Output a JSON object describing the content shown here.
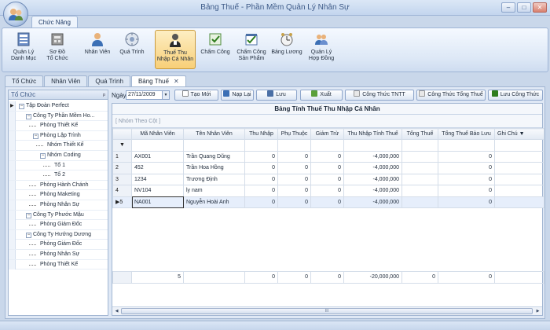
{
  "window": {
    "title": "Bảng Thuế - Phần Mềm Quản Lý Nhân Sự",
    "buttons": {
      "minimize": "–",
      "maximize": "□",
      "close": "✕"
    }
  },
  "ribbon": {
    "tab_label": "Chức Năng",
    "buttons": [
      {
        "line1": "Quản Lý",
        "line2": "Danh Mục",
        "icon": "catalog-icon"
      },
      {
        "line1": "Sơ Đồ",
        "line2": "Tổ Chức",
        "icon": "org-chart-icon"
      },
      {
        "line1": "Nhân Viên",
        "line2": "",
        "icon": "employee-icon"
      },
      {
        "line1": "Quá Trình",
        "line2": "",
        "icon": "process-icon"
      },
      {
        "line1": "Thuế Thu",
        "line2": "Nhập Cá Nhân",
        "icon": "tax-icon"
      },
      {
        "line1": "Chấm Công",
        "line2": "",
        "icon": "attendance-icon"
      },
      {
        "line1": "Chấm Công",
        "line2": "Sản Phẩm",
        "icon": "product-attendance-icon"
      },
      {
        "line1": "Bảng Lương",
        "line2": "",
        "icon": "payroll-icon"
      },
      {
        "line1": "Quản Lý",
        "line2": "Hợp Đồng",
        "icon": "contract-icon"
      }
    ]
  },
  "doc_tabs": [
    "Tổ Chức",
    "Nhân Viên",
    "Quá Trình",
    "Bảng Thuế"
  ],
  "doc_tab_close": "✕",
  "left_panel": {
    "title": "Tổ Chức",
    "pin": "ᵖ",
    "tree": [
      {
        "label": "Tập Đoàn Perfect",
        "level": 0,
        "expander": "−",
        "selected": true
      },
      {
        "label": "Công Ty Phần Mềm Ho...",
        "level": 1,
        "expander": "−"
      },
      {
        "label": "Phòng Thiết Kế",
        "level": 2
      },
      {
        "label": "Phòng Lập Trình",
        "level": 2,
        "expander": "−"
      },
      {
        "label": "Nhóm Thiết Kế",
        "level": 3
      },
      {
        "label": "Nhóm Coding",
        "level": 3,
        "expander": "−"
      },
      {
        "label": "Tổ 1",
        "level": 4
      },
      {
        "label": "Tổ 2",
        "level": 4
      },
      {
        "label": "Phòng Hành Chánh",
        "level": 2
      },
      {
        "label": "Phòng Maketing",
        "level": 2
      },
      {
        "label": "Phòng Nhân Sự",
        "level": 2
      },
      {
        "label": "Công Ty Phước Mậu",
        "level": 1,
        "expander": "−"
      },
      {
        "label": "Phòng Giám Đốc",
        "level": 2
      },
      {
        "label": "Công Ty Hướng Dương",
        "level": 1,
        "expander": "−"
      },
      {
        "label": "Phòng Giám Đốc",
        "level": 2
      },
      {
        "label": "Phòng Nhân Sự",
        "level": 2
      },
      {
        "label": "Phòng Thiết Kế",
        "level": 2
      }
    ]
  },
  "toolbar": {
    "date_label": "Ngày",
    "date_value": "27/11/2009",
    "date_dropdown": "▼",
    "new_button": "Tạo Mới",
    "reload_button": "Nạp Lại",
    "save_button": "Lưu",
    "export_button": "Xuất",
    "tntt_formula_button": "Công Thức TNTT",
    "total_tax_formula_button": "Công Thức Tổng Thuế",
    "save_formula_button": "Lưu Công Thức"
  },
  "grid": {
    "title": "Bảng Tính Thuế Thu Nhập Cá Nhân",
    "group_placeholder": "[ Nhóm Theo Cột ]",
    "filter_marker": "▼",
    "sort_arrow": "▼",
    "current_row_marker": "▶",
    "scroll_left": "◀",
    "scroll_right": "▶",
    "scroll_grip": "III",
    "columns": [
      "Mã Nhân Viên",
      "Tên Nhân Viên",
      "Thu Nhập",
      "Phụ Thuộc",
      "Giảm Trừ",
      "Thu Nhập Tính Thuế",
      "Tổng Thuế",
      "Tổng Thuế Bảo Lưu",
      "Ghi Chú"
    ],
    "rows": [
      {
        "no": "1",
        "cells": [
          "AX001",
          "Trần Quang  Dũng",
          "0",
          "0",
          "0",
          "-4,000,000",
          "",
          "0",
          ""
        ]
      },
      {
        "no": "2",
        "cells": [
          "452",
          "Trần Hoa Hồng",
          "0",
          "0",
          "0",
          "-4,000,000",
          "",
          "0",
          ""
        ]
      },
      {
        "no": "3",
        "cells": [
          "1234",
          "Trương  Định",
          "0",
          "0",
          "0",
          "-4,000,000",
          "",
          "0",
          ""
        ]
      },
      {
        "no": "4",
        "cells": [
          "NV104",
          "ly nam",
          "0",
          "0",
          "0",
          "-4,000,000",
          "",
          "0",
          ""
        ]
      },
      {
        "no": "5",
        "cells": [
          "NA001",
          "Nguyễn Hoài Anh",
          "0",
          "0",
          "0",
          "-4,000,000",
          "",
          "0",
          ""
        ]
      }
    ],
    "footer": [
      "5",
      "",
      "0",
      "0",
      "0",
      "-20,000,000",
      "0",
      "0",
      ""
    ]
  }
}
